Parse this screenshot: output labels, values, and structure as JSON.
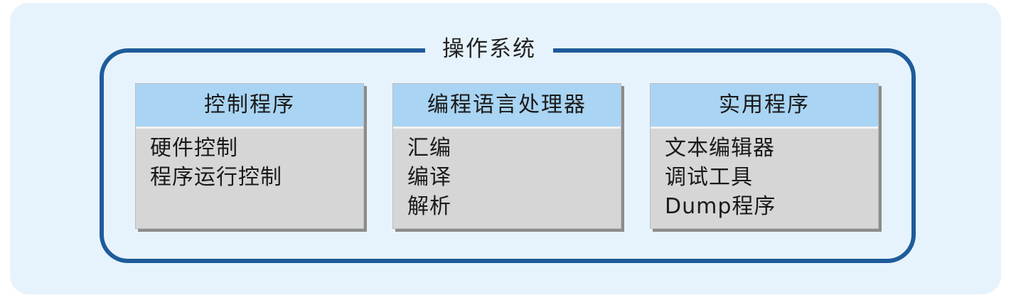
{
  "diagram": {
    "title": "操作系统",
    "modules": [
      {
        "header": "控制程序",
        "items": [
          "硬件控制",
          "程序运行控制"
        ]
      },
      {
        "header": "编程语言处理器",
        "items": [
          "汇编",
          "编译",
          "解析"
        ]
      },
      {
        "header": "实用程序",
        "items": [
          "文本编辑器",
          "调试工具",
          "Dump程序"
        ]
      }
    ]
  },
  "colors": {
    "background_panel": "#e7f3fc",
    "frame_border": "#1e5b9a",
    "module_header": "#a9d4f3",
    "module_body": "#d6d6d6",
    "module_shadow": "#8c8c8c"
  }
}
